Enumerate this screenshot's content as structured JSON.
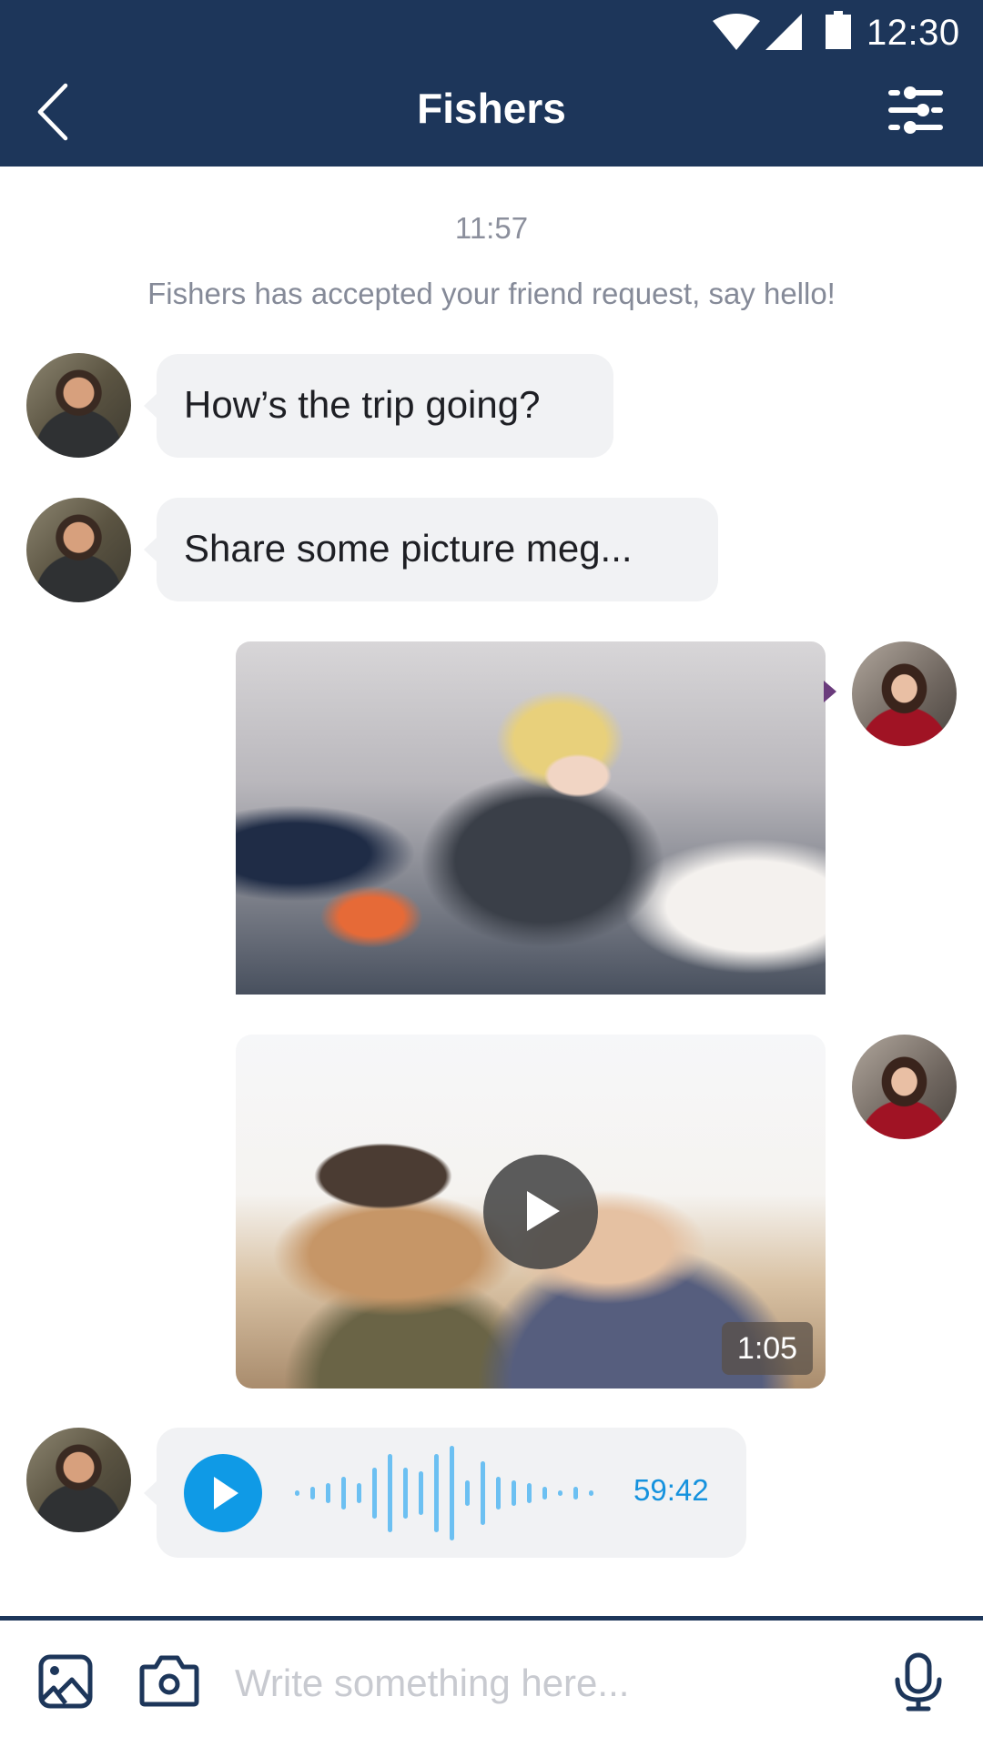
{
  "status_bar": {
    "time": "12:30",
    "icons": [
      "wifi-icon",
      "cell-signal-icon",
      "battery-icon"
    ]
  },
  "header": {
    "title": "Fishers",
    "back_icon": "chevron-left-icon",
    "filter_icon": "sliders-icon"
  },
  "conversation": {
    "timestamp": "11:57",
    "system_message": "Fishers has accepted your friend request, say hello!",
    "messages": [
      {
        "type": "text",
        "sender": "contact",
        "text": "How’s the trip going?"
      },
      {
        "type": "text",
        "sender": "contact",
        "text": "Share some picture meg..."
      },
      {
        "type": "image",
        "sender": "me",
        "alt": "Woman laughing in a pillow fight with feathers"
      },
      {
        "type": "video",
        "sender": "me",
        "alt": "Two women laughing outdoors at sunset",
        "duration": "1:05"
      },
      {
        "type": "voice",
        "sender": "contact",
        "duration": "59:42",
        "waveform_levels": [
          0.1,
          0.3,
          0.45,
          0.75,
          0.45,
          1.2,
          1.8,
          1.2,
          1.0,
          1.8,
          2.2,
          0.6,
          1.5,
          0.75,
          0.6,
          0.45,
          0.3,
          0.1,
          0.3,
          0.1
        ]
      }
    ]
  },
  "composer": {
    "placeholder": "Write something here...",
    "value": "",
    "icons": [
      "gallery-icon",
      "camera-icon",
      "microphone-icon"
    ]
  },
  "colors": {
    "header_bg": "#1d365a",
    "bubble_bg": "#f1f2f4",
    "accent_blue": "#0f9ae6",
    "waveform": "#6cc0f2"
  }
}
